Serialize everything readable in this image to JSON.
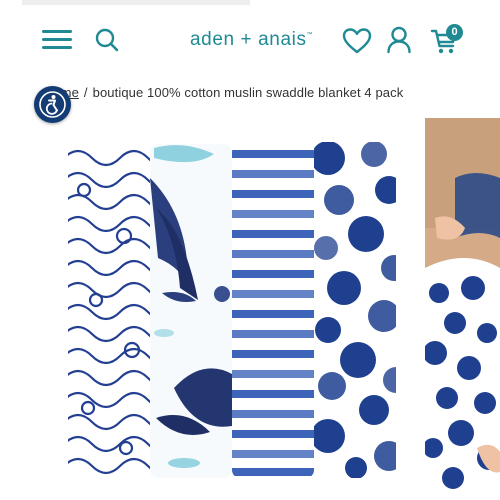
{
  "header": {
    "logo_text": "aden + anais",
    "logo_mark": "™",
    "menu_icon": "hamburger-menu-icon",
    "search_icon": "search-icon",
    "wishlist_icon": "heart-icon",
    "account_icon": "user-icon",
    "cart_icon": "cart-icon",
    "cart_count": "0"
  },
  "breadcrumb": {
    "home_label": "home",
    "separator": "/",
    "current": "boutique 100% cotton muslin swaddle blanket 4 pack"
  },
  "accessibility_icon": "accessibility-icon",
  "colors": {
    "brand_teal": "#1f8a93",
    "accessibility_navy": "#123c73",
    "navy": "#1f3f8f",
    "light_blue": "#6ec3d6"
  },
  "product": {
    "swaddle_patterns": [
      "waves",
      "whale",
      "stripes",
      "dots"
    ]
  }
}
